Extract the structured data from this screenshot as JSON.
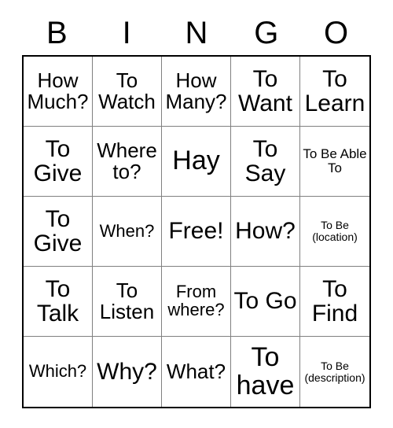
{
  "card": {
    "header_letters": [
      "B",
      "I",
      "N",
      "G",
      "O"
    ],
    "rows": [
      [
        {
          "text": "How Much?",
          "size": "lg"
        },
        {
          "text": "To Watch",
          "size": "lg"
        },
        {
          "text": "How Many?",
          "size": "lg"
        },
        {
          "text": "To Want",
          "size": "xl"
        },
        {
          "text": "To Learn",
          "size": "xl"
        }
      ],
      [
        {
          "text": "To Give",
          "size": "xl"
        },
        {
          "text": "Where to?",
          "size": "lg"
        },
        {
          "text": "Hay",
          "size": "xxl"
        },
        {
          "text": "To Say",
          "size": "xl"
        },
        {
          "text": "To Be Able To",
          "size": "sm"
        }
      ],
      [
        {
          "text": "To Give",
          "size": "xl"
        },
        {
          "text": "When?",
          "size": "md"
        },
        {
          "text": "Free!",
          "size": "xl"
        },
        {
          "text": "How?",
          "size": "xl"
        },
        {
          "text": "To Be (location)",
          "size": "xs"
        }
      ],
      [
        {
          "text": "To Talk",
          "size": "xl"
        },
        {
          "text": "To Listen",
          "size": "lg"
        },
        {
          "text": "From where?",
          "size": "md"
        },
        {
          "text": "To Go",
          "size": "xl"
        },
        {
          "text": "To Find",
          "size": "xl"
        }
      ],
      [
        {
          "text": "Which?",
          "size": "md"
        },
        {
          "text": "Why?",
          "size": "xl"
        },
        {
          "text": "What?",
          "size": "lg"
        },
        {
          "text": "To have",
          "size": "xxl"
        },
        {
          "text": "To Be (description)",
          "size": "xs"
        }
      ]
    ]
  },
  "colors": {
    "background": "#ffffff",
    "text": "#000000",
    "outer_border": "#000000",
    "inner_grid_line": "#808080"
  }
}
